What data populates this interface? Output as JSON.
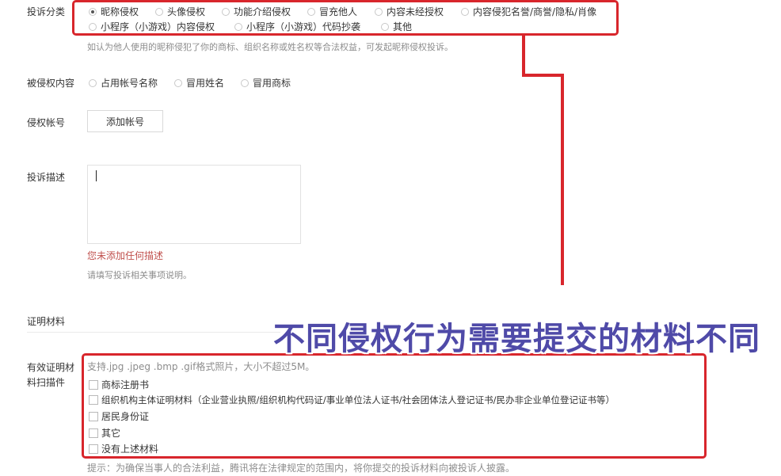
{
  "complaint_category": {
    "label": "投诉分类",
    "options_row1": [
      "昵称侵权",
      "头像侵权",
      "功能介绍侵权",
      "冒充他人",
      "内容未经授权",
      "内容侵犯名誉/商誉/隐私/肖像"
    ],
    "options_row2": [
      "小程序（小游戏）内容侵权",
      "小程序（小游戏）代码抄袭",
      "其他"
    ],
    "selected": "昵称侵权",
    "hint": "如认为他人使用的昵称侵犯了你的商标、组织名称或姓名权等合法权益，可发起昵称侵权投诉。"
  },
  "infringed_content": {
    "label": "被侵权内容",
    "options": [
      "占用帐号名称",
      "冒用姓名",
      "冒用商标"
    ]
  },
  "infringing_account": {
    "label": "侵权帐号",
    "button": "添加帐号"
  },
  "description": {
    "label": "投诉描述",
    "value": "",
    "error": "您未添加任何描述",
    "hint": "请填写投诉相关事项说明。"
  },
  "proof_section": {
    "title": "证明材料"
  },
  "proof_scans": {
    "label_line1": "有效证明材",
    "label_line2": "料扫描件",
    "format_hint": "支持.jpg .jpeg .bmp .gif格式照片，大小不超过5M。",
    "options": [
      "商标注册书",
      "组织机构主体证明材料（企业营业执照/组织机构代码证/事业单位法人证书/社会团体法人登记证书/民办非企业单位登记证书等）",
      "居民身份证",
      "其它",
      "没有上述材料"
    ],
    "notice": "提示：为确保当事人的合法利益，腾讯将在法律规定的范围内，将你提交的投诉材料向被投诉人披露。"
  },
  "annotation": {
    "text": "不同侵权行为需要提交的材料不同",
    "colors": {
      "annotation": "#4f4aa8",
      "highlight": "#d8262c"
    }
  }
}
